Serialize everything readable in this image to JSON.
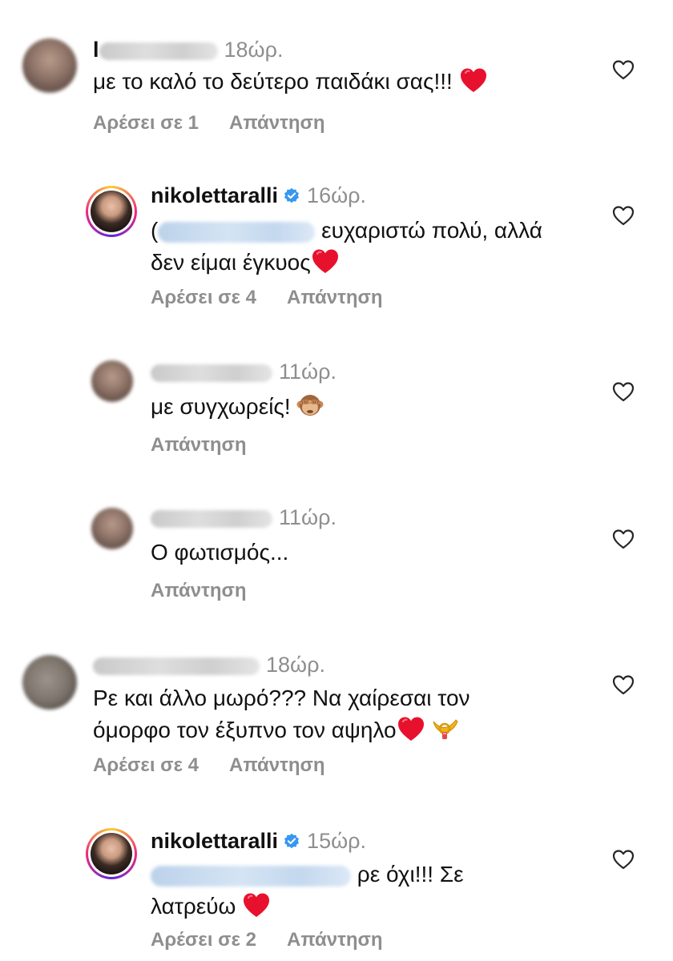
{
  "comments": [
    {
      "username": "",
      "username_initial": "l",
      "time": "18ώρ.",
      "text": "με το καλό το δεύτερο παιδάκι σας!!!",
      "emoji": "heart-emoji",
      "likes_label": "Αρέσει σε 1",
      "reply_label": "Απάντηση"
    },
    {
      "username": "nikolettaralli",
      "verified": true,
      "time": "16ώρ.",
      "mention_prefix": "(",
      "text_line1": "ευχαριστώ πολύ, αλλά",
      "text_line2": "δεν είμαι έγκυος",
      "emoji": "heart-emoji",
      "likes_label": "Αρέσει σε 4",
      "reply_label": "Απάντηση"
    },
    {
      "username": "",
      "time": "11ώρ.",
      "text": "με συγχωρείς!",
      "emoji": "see-no-evil-monkey-emoji",
      "reply_label": "Απάντηση"
    },
    {
      "username": "",
      "time": "11ώρ.",
      "text": "Ο φωτισμός...",
      "reply_label": "Απάντηση"
    },
    {
      "username": "",
      "time": "18ώρ.",
      "text_line1": "Ρε και άλλο μωρό??? Να χαίρεσαι τον",
      "text_line2": "όμορφο τον έξυπνο τον αψηλο",
      "emoji": "heart-emoji",
      "emoji2": "postal-horn-emoji",
      "likes_label": "Αρέσει σε 4",
      "reply_label": "Απάντηση"
    },
    {
      "username": "nikolettaralli",
      "verified": true,
      "time": "15ώρ.",
      "text_line1": "ρε όχι!!! Σε",
      "text_line2": "λατρεύω",
      "emoji": "heart-emoji",
      "likes_label": "Αρέσει σε 2",
      "reply_label": "Απάντηση"
    }
  ],
  "colors": {
    "text": "#111111",
    "muted": "#8e8e8e",
    "verified_blue": "#3897f0",
    "heart_red": "#e8112d"
  }
}
